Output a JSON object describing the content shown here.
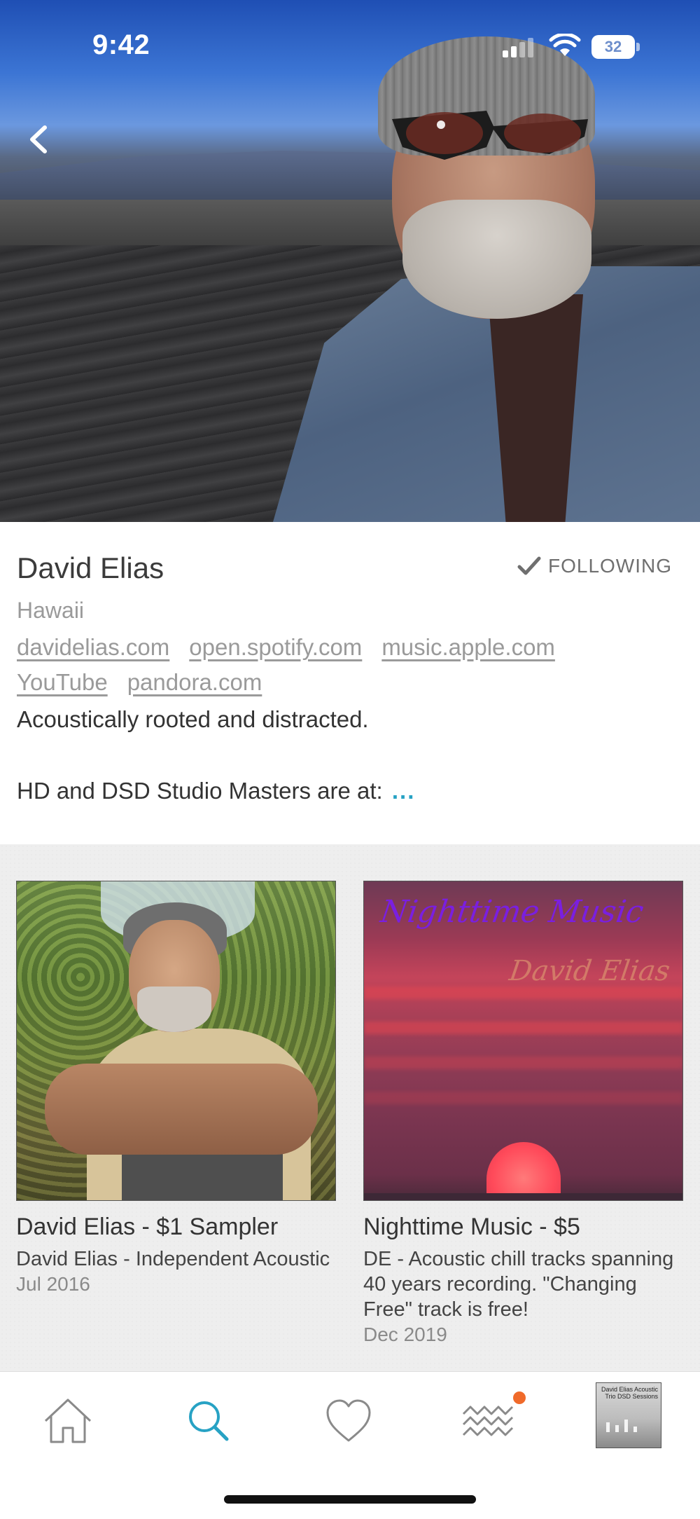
{
  "status_bar": {
    "time": "9:42",
    "battery": "32"
  },
  "profile": {
    "name": "David Elias",
    "follow_label": "FOLLOWING",
    "location": "Hawaii",
    "links": [
      "davidelias.com",
      "open.spotify.com",
      "music.apple.com",
      "YouTube",
      "pandora.com"
    ],
    "bio_line1": "Acoustically rooted and distracted.",
    "bio_line2": "HD and DSD Studio Masters are at:",
    "more": "..."
  },
  "releases": [
    {
      "title": "David Elias - $1 Sampler",
      "description": "David Elias - Independent Acoustic",
      "date": "Jul 2016"
    },
    {
      "title": "Nighttime Music - $5",
      "description": "DE - Acoustic chill tracks spanning 40 years recording. \"Changing Free\" track is free!",
      "date": "Dec 2019",
      "cover_title": "Nighttime Music",
      "cover_artist": "David Elias"
    }
  ],
  "tab_bar": {
    "items": [
      "home-icon",
      "search-icon",
      "heart-icon",
      "feed-icon"
    ],
    "now_playing_cover_text": "David Elias Acoustic Trio DSD Sessions"
  },
  "colors": {
    "accent": "#27a2c4",
    "notification_dot": "#f06a2a",
    "link_gray": "#9a9a9a"
  }
}
